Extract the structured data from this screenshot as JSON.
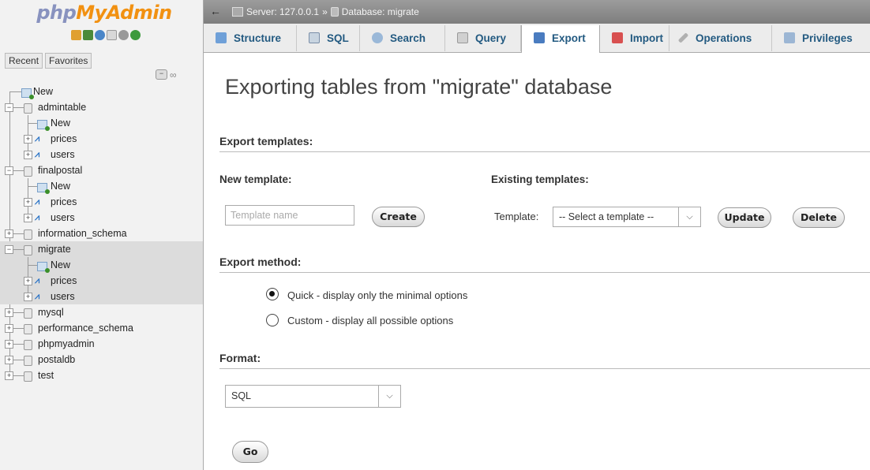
{
  "logo": {
    "part1": "php",
    "part2": "MyAdmin"
  },
  "nav_icons": [
    "home-icon",
    "logout-icon",
    "docs-icon",
    "sql-docs-icon",
    "settings-icon",
    "reload-icon"
  ],
  "nav_tabs": {
    "recent": "Recent",
    "favorites": "Favorites"
  },
  "tree": {
    "new": "New",
    "dbs": [
      {
        "name": "admintable",
        "children": [
          "New",
          "prices",
          "users"
        ]
      },
      {
        "name": "finalpostal",
        "children": [
          "New",
          "prices",
          "users"
        ]
      },
      {
        "name": "information_schema"
      },
      {
        "name": "migrate",
        "children": [
          "New",
          "prices",
          "users"
        ]
      },
      {
        "name": "mysql"
      },
      {
        "name": "performance_schema"
      },
      {
        "name": "phpmyadmin"
      },
      {
        "name": "postaldb"
      },
      {
        "name": "test"
      }
    ]
  },
  "breadcrumb": {
    "server": "Server: 127.0.0.1",
    "sep": "»",
    "database": "Database: migrate"
  },
  "tabs": [
    "Structure",
    "SQL",
    "Search",
    "Query",
    "Export",
    "Import",
    "Operations",
    "Privileges"
  ],
  "active_tab": "Export",
  "main": {
    "title": "Exporting tables from \"migrate\" database",
    "export_templates": "Export templates:",
    "new_template": "New template:",
    "template_placeholder": "Template name",
    "create": "Create",
    "existing_templates": "Existing templates:",
    "template_label": "Template:",
    "template_select": "-- Select a template --",
    "update": "Update",
    "delete": "Delete",
    "export_method": "Export method:",
    "quick": "Quick - display only the minimal options",
    "custom": "Custom - display all possible options",
    "format": "Format:",
    "format_value": "SQL",
    "go": "Go"
  },
  "colors": {
    "logo_php": "#8892bf",
    "logo_admin": "#f29111",
    "tab_text": "#235a81",
    "topbar": "#8a8a8a"
  }
}
